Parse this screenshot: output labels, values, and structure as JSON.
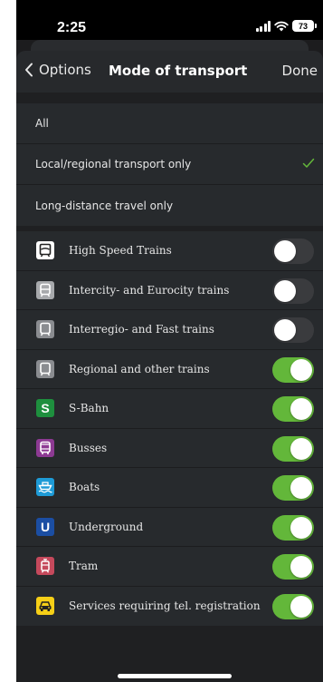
{
  "status_bar": {
    "time": "2:25",
    "battery": "73"
  },
  "navbar": {
    "back_label": "Options",
    "title": "Mode of transport",
    "done_label": "Done"
  },
  "filters": [
    {
      "label": "All",
      "selected": false
    },
    {
      "label": "Local/regional transport only",
      "selected": true
    },
    {
      "label": "Long-distance travel only",
      "selected": false
    }
  ],
  "transport_modes": [
    {
      "label": "High Speed Trains",
      "icon": "high-speed-train-icon",
      "color": "#ffffff",
      "enabled": false
    },
    {
      "label": "Intercity- and Eurocity trains",
      "icon": "intercity-train-icon",
      "color": "#a7a9ac",
      "enabled": false
    },
    {
      "label": "Interregio- and Fast trains",
      "icon": "interregio-train-icon",
      "color": "#8a8c90",
      "enabled": false
    },
    {
      "label": "Regional and other trains",
      "icon": "regional-train-icon",
      "color": "#8a8c90",
      "enabled": true
    },
    {
      "label": "S-Bahn",
      "icon": "s-bahn-icon",
      "color": "#1e8f3e",
      "enabled": true
    },
    {
      "label": "Busses",
      "icon": "bus-icon",
      "color": "#8d3a93",
      "enabled": true
    },
    {
      "label": "Boats",
      "icon": "boat-icon",
      "color": "#1e9bd7",
      "enabled": true
    },
    {
      "label": "Underground",
      "icon": "underground-icon",
      "color": "#1b4ea3",
      "enabled": true
    },
    {
      "label": "Tram",
      "icon": "tram-icon",
      "color": "#c5495c",
      "enabled": true
    },
    {
      "label": "Services requiring tel. registration",
      "icon": "on-demand-service-icon",
      "color": "#f6cf17",
      "enabled": true
    }
  ],
  "colors": {
    "toggle_on": "#63b73a",
    "toggle_off": "#3a3b3e",
    "checkmark": "#63b73a"
  },
  "icon_letters": {
    "s_bahn": "S",
    "underground": "U"
  }
}
